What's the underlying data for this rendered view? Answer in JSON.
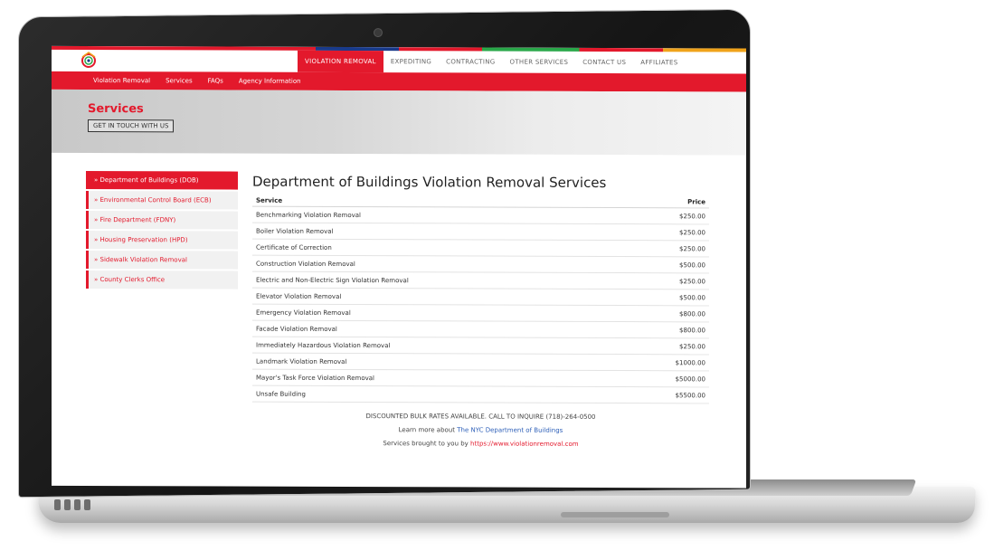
{
  "nav": {
    "top_items": [
      "VIOLATION REMOVAL",
      "EXPEDITING",
      "CONTRACTING",
      "OTHER SERVICES",
      "CONTACT US",
      "AFFILIATES"
    ],
    "sub_items": [
      "Violation Removal",
      "Services",
      "FAQs",
      "Agency Information"
    ]
  },
  "hero": {
    "title": "Services",
    "button": "GET IN TOUCH WITH US"
  },
  "sidebar": {
    "items": [
      "» Department of Buildings (DOB)",
      "» Environmental Control Board (ECB)",
      "» Fire Department (FDNY)",
      "» Housing Preservation (HPD)",
      "» Sidewalk Violation Removal",
      "» County Clerks Office"
    ]
  },
  "main": {
    "heading": "Department of Buildings Violation Removal Services",
    "table": {
      "headers": [
        "Service",
        "Price"
      ],
      "rows": [
        [
          "Benchmarking Violation Removal",
          "$250.00"
        ],
        [
          "Boiler Violation Removal",
          "$250.00"
        ],
        [
          "Certificate of Correction",
          "$250.00"
        ],
        [
          "Construction Violation Removal",
          "$500.00"
        ],
        [
          "Electric and Non-Electric Sign Violation Removal",
          "$250.00"
        ],
        [
          "Elevator Violation Removal",
          "$500.00"
        ],
        [
          "Emergency Violation Removal",
          "$800.00"
        ],
        [
          "Facade Violation Removal",
          "$800.00"
        ],
        [
          "Immediately Hazardous Violation Removal",
          "$250.00"
        ],
        [
          "Landmark Violation Removal",
          "$1000.00"
        ],
        [
          "Mayor's Task Force Violation Removal",
          "$5000.00"
        ],
        [
          "Unsafe Building",
          "$5500.00"
        ]
      ]
    },
    "note_bulk": "DISCOUNTED BULK RATES AVAILABLE. CALL TO INQUIRE (718)-264-0500",
    "note_learn_prefix": "Learn more about",
    "note_learn_link": "The NYC Department of Buildings",
    "note_brought_prefix": "Services brought to you by",
    "note_brought_link": "https://www.violationremoval.com"
  },
  "colors": {
    "accent": "#e3192c",
    "link": "#2d5fb8"
  }
}
